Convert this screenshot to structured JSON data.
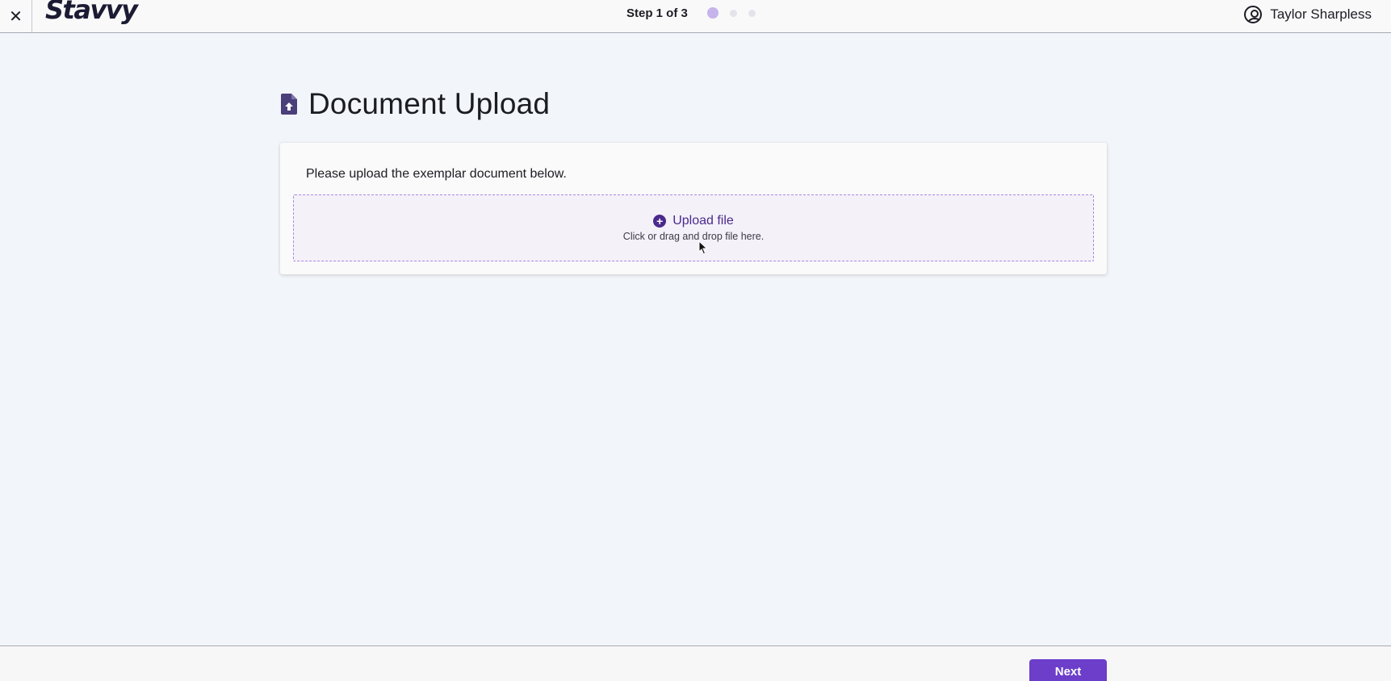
{
  "header": {
    "close_glyph": "✕",
    "logo": "Stavvy",
    "step_text": "Step 1 of 3",
    "steps_total": 3,
    "steps_current": 1,
    "user_name": "Taylor Sharpless"
  },
  "main": {
    "title": "Document Upload",
    "instruction": "Please upload the exemplar document below.",
    "upload_label": "Upload file",
    "upload_hint": "Click or drag and drop file here."
  },
  "footer": {
    "next_label": "Next"
  },
  "colors": {
    "accent": "#6c3ec9",
    "accent_dark": "#4b2a8c",
    "step_active": "#c6b4ec",
    "background": "#f2f5fa"
  }
}
